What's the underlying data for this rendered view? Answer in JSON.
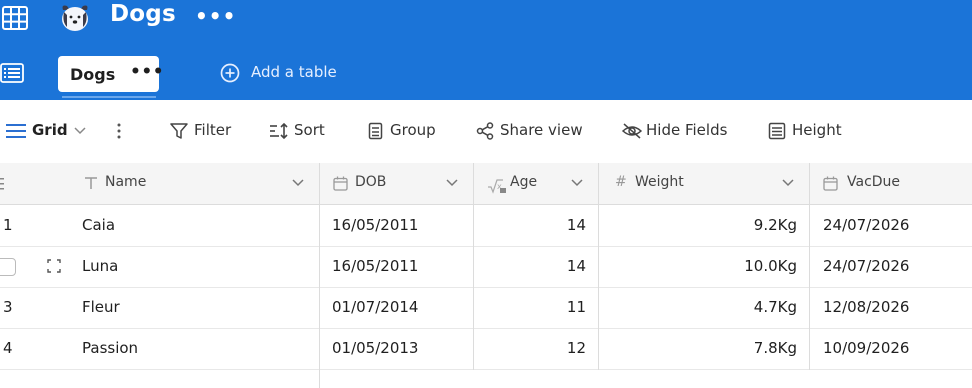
{
  "header": {
    "base_title": "Dogs",
    "more": "•••",
    "tab_label": "Dogs",
    "tab_more": "•••",
    "add_table": "Add a table",
    "icons": [
      "apps-grid-icon",
      "dog-logo-icon",
      "list-icon",
      "plus-circle-icon"
    ],
    "color": "#1b74d8"
  },
  "toolbar": {
    "grid": "Grid",
    "filter": "Filter",
    "sort": "Sort",
    "group": "Group",
    "share": "Share view",
    "hide": "Hide Fields",
    "height": "Height"
  },
  "columns": [
    {
      "label": "Name",
      "type_icon": "text-icon"
    },
    {
      "label": "DOB",
      "type_icon": "calendar-icon"
    },
    {
      "label": "Age",
      "type_icon": "formula-icon"
    },
    {
      "label": "Weight",
      "type_icon": "number-icon"
    },
    {
      "label": "VacDue",
      "type_icon": "calendar-icon"
    }
  ],
  "rows": [
    {
      "id": "1",
      "name": "Caia",
      "dob": "16/05/2011",
      "age": "14",
      "weight": "9.2Kg",
      "vacdue": "24/07/2026"
    },
    {
      "id": "",
      "name": "Luna",
      "dob": "16/05/2011",
      "age": "14",
      "weight": "10.0Kg",
      "vacdue": "24/07/2026"
    },
    {
      "id": "3",
      "name": "Fleur",
      "dob": "01/07/2014",
      "age": "11",
      "weight": "4.7Kg",
      "vacdue": "12/08/2026"
    },
    {
      "id": "4",
      "name": "Passion",
      "dob": "01/05/2013",
      "age": "12",
      "weight": "7.8Kg",
      "vacdue": "10/09/2026"
    }
  ]
}
